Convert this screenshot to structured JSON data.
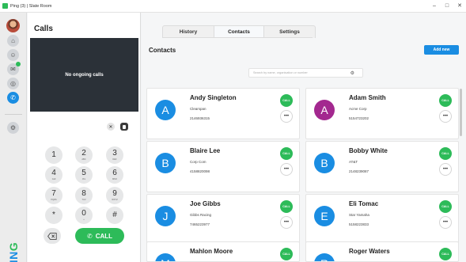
{
  "window": {
    "title": "Ping (3) | Slate Room",
    "controls": {
      "minimize": "–",
      "maximize": "□",
      "close": "✕"
    }
  },
  "rail": {
    "items": [
      {
        "icon": "home-icon",
        "glyph": "⌂"
      },
      {
        "icon": "contacts-icon",
        "glyph": "☺"
      },
      {
        "icon": "chat-icon",
        "glyph": "✉"
      },
      {
        "icon": "voicemail-icon",
        "glyph": "◎"
      },
      {
        "icon": "phone-icon",
        "glyph": "✆"
      },
      {
        "icon": "settings-icon",
        "glyph": "⚙"
      }
    ],
    "brand_main": "PIN",
    "brand_accent": "G"
  },
  "calls": {
    "title": "Calls",
    "no_calls": "No ongoing calls",
    "clear": "✕",
    "keys": [
      {
        "d": "1",
        "l": ""
      },
      {
        "d": "2",
        "l": "ABC"
      },
      {
        "d": "3",
        "l": "DEF"
      },
      {
        "d": "4",
        "l": "GHI"
      },
      {
        "d": "5",
        "l": "JKL"
      },
      {
        "d": "6",
        "l": "MNO"
      },
      {
        "d": "7",
        "l": "PQRS"
      },
      {
        "d": "8",
        "l": "TUV"
      },
      {
        "d": "9",
        "l": "WXYZ"
      },
      {
        "d": "*",
        "l": ""
      },
      {
        "d": "0",
        "l": "+"
      },
      {
        "d": "#",
        "l": ""
      }
    ],
    "call_label": "CALL"
  },
  "main": {
    "tabs": [
      {
        "label": "History",
        "active": false
      },
      {
        "label": "Contacts",
        "active": true
      },
      {
        "label": "Settings",
        "active": false
      }
    ],
    "title": "Contacts",
    "add_label": "Add new",
    "search_placeholder": "Search by name, organisation or number",
    "call_label": "CALL",
    "more_label": "•••",
    "contacts": [
      {
        "name": "Andy Singleton",
        "initial": "A",
        "org": "Clearspan",
        "phone": "2146936315",
        "color": "#1a8de2"
      },
      {
        "name": "Adam Smith",
        "initial": "A",
        "org": "Acme Corp",
        "phone": "5154723202",
        "color": "#a3288f"
      },
      {
        "name": "Blaire Lee",
        "initial": "B",
        "org": "Corp Com",
        "phone": "4158820098",
        "color": "#1a8de2"
      },
      {
        "name": "Bobby White",
        "initial": "B",
        "org": "AT&T",
        "phone": "2148239087",
        "color": "#1a8de2"
      },
      {
        "name": "Joe Gibbs",
        "initial": "J",
        "org": "Gibbs Racing",
        "phone": "7465223977",
        "color": "#1a8de2"
      },
      {
        "name": "Eli Tomac",
        "initial": "E",
        "org": "Star Yamaha",
        "phone": "5158223833",
        "color": "#1a8de2"
      },
      {
        "name": "Mahlon Moore",
        "initial": "M",
        "org": "",
        "phone": "",
        "color": "#1a8de2"
      },
      {
        "name": "Roger Waters",
        "initial": "R",
        "org": "",
        "phone": "",
        "color": "#1a8de2"
      }
    ]
  }
}
